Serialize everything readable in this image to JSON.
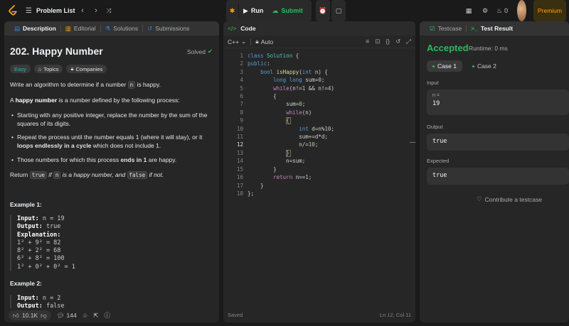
{
  "header": {
    "problem_list": "Problem List",
    "run": "Run",
    "submit": "Submit",
    "streak_count": "0",
    "premium": "Premium"
  },
  "left_tabs": [
    {
      "label": "Description",
      "icon": "description-icon"
    },
    {
      "label": "Editorial",
      "icon": "book-icon"
    },
    {
      "label": "Solutions",
      "icon": "flask-icon"
    },
    {
      "label": "Submissions",
      "icon": "history-icon"
    }
  ],
  "problem": {
    "title": "202. Happy Number",
    "status": "Solved",
    "difficulty": "Easy",
    "tag_topics": "Topics",
    "tag_companies": "Companies",
    "intro_pre": "Write an algorithm to determine if a number ",
    "intro_code": "n",
    "intro_post": " is happy.",
    "def_pre": "A ",
    "def_bold": "happy number",
    "def_post": " is a number defined by the following process:",
    "bullet1": "Starting with any positive integer, replace the number by the sum of the squares of its digits.",
    "bullet2_pre": "Repeat the process until the number equals 1 (where it will stay), or it ",
    "bullet2_bold": "loops endlessly in a cycle",
    "bullet2_post": " which does not include 1.",
    "bullet3_pre": "Those numbers for which this process ",
    "bullet3_bold": "ends in 1",
    "bullet3_post": " are happy.",
    "return_pre": "Return ",
    "return_true": "true",
    "return_if": " if ",
    "return_n": "n",
    "return_mid": " is a happy number, and ",
    "return_false": "false",
    "return_post": " if not.",
    "example1_title": "Example 1:",
    "example1_input_label": "Input:",
    "example1_input": " n = 19",
    "example1_output_label": "Output:",
    "example1_output": " true",
    "example1_expl_label": "Explanation:",
    "example1_lines": [
      "1² + 9² = 82",
      "8² + 2² = 68",
      "6² + 8² = 100",
      "1² + 0² + 0² = 1"
    ],
    "example2_title": "Example 2:",
    "example2_input_label": "Input:",
    "example2_input": " n = 2",
    "example2_output_label": "Output:",
    "example2_output": " false"
  },
  "footer": {
    "likes": "10.1K",
    "comments": "144"
  },
  "code_panel": {
    "title": "Code",
    "language": "C++",
    "mode": "Auto",
    "saved": "Saved",
    "cursor": "Ln 12, Col 11",
    "line_numbers": [
      "1",
      "2",
      "3",
      "4",
      "5",
      "6",
      "7",
      "8",
      "9",
      "10",
      "11",
      "12",
      "13",
      "14",
      "15",
      "16",
      "17",
      "18"
    ]
  },
  "right_panel": {
    "tab_testcase": "Testcase",
    "tab_result": "Test Result",
    "verdict": "Accepted",
    "runtime": "Runtime: 0 ms",
    "case1": "Case 1",
    "case2": "Case 2",
    "input_label": "Input",
    "input_var": "n =",
    "input_value": "19",
    "output_label": "Output",
    "output_value": "true",
    "expected_label": "Expected",
    "expected_value": "true",
    "contribute": "Contribute a testcase"
  },
  "colors": {
    "accent_green": "#2cbb5d",
    "premium_orange": "#ffa116",
    "easy_teal": "#1cb8b8"
  }
}
